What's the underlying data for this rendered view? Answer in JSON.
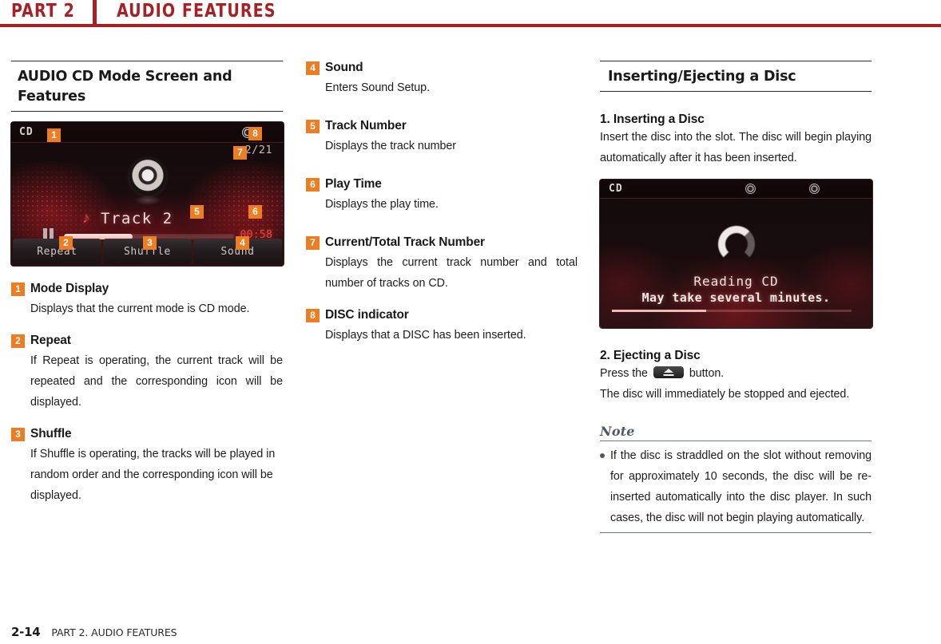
{
  "header": {
    "part_label": "PART 2",
    "title": "AUDIO FEATURES"
  },
  "left_column": {
    "heading": "AUDIO CD Mode Screen and Features",
    "player_screen": {
      "mode_label": "CD",
      "track_count": "2/21",
      "track_title": "Track  2",
      "note_glyph": "♪",
      "play_time": "00:58",
      "buttons": [
        "Repeat",
        "Shuffle",
        "Sound"
      ],
      "overlay_badges": [
        "1",
        "2",
        "3",
        "4",
        "5",
        "6",
        "7",
        "8"
      ]
    },
    "items": [
      {
        "num": "1",
        "title": "Mode Display",
        "body": "Displays that the current mode is CD mode."
      },
      {
        "num": "2",
        "title": "Repeat",
        "body": "If Repeat is operating, the current track will be repeated and the corresponding icon will be displayed."
      },
      {
        "num": "3",
        "title": "Shuffle",
        "body": "If Shuffle is operating, the tracks will be played in random order and the corresponding icon will be displayed."
      }
    ]
  },
  "middle_column": {
    "items": [
      {
        "num": "4",
        "title": "Sound",
        "body": "Enters Sound Setup."
      },
      {
        "num": "5",
        "title": "Track Number",
        "body": "Displays the track number"
      },
      {
        "num": "6",
        "title": "Play Time",
        "body": "Displays the play time."
      },
      {
        "num": "7",
        "title": "Current/Total Track Number",
        "body": "Displays the current track number and total number of tracks on CD."
      },
      {
        "num": "8",
        "title": "DISC indicator",
        "body": "Displays that a DISC has been inserted."
      }
    ]
  },
  "right_column": {
    "heading": "Inserting/Ejecting a Disc",
    "insert": {
      "title": "1. Inserting a Disc",
      "body": "Insert the disc into the slot. The disc will begin playing automatically after it has been inserted."
    },
    "reading_screen": {
      "mode_label": "CD",
      "line1": "Reading CD",
      "line2": "May take several minutes."
    },
    "eject": {
      "title": "2. Ejecting a Disc",
      "line_prefix": "Press the",
      "line_suffix": "button.",
      "body": "The disc will immediately be stopped and ejected."
    },
    "note": {
      "title": "Note",
      "bullets": [
        "If the disc is straddled on the slot without removing for approximately 10 seconds, the disc will be re-inserted automatically into the disc player. In such cases, the disc will not begin playing automatically."
      ]
    }
  },
  "footer": {
    "page_number": "2-14",
    "section": "PART 2. AUDIO FEATURES"
  },
  "colors": {
    "brand_red": "#a81f24",
    "badge_orange": "#ee7d22",
    "note_blue_gray": "#4a5a6a"
  }
}
